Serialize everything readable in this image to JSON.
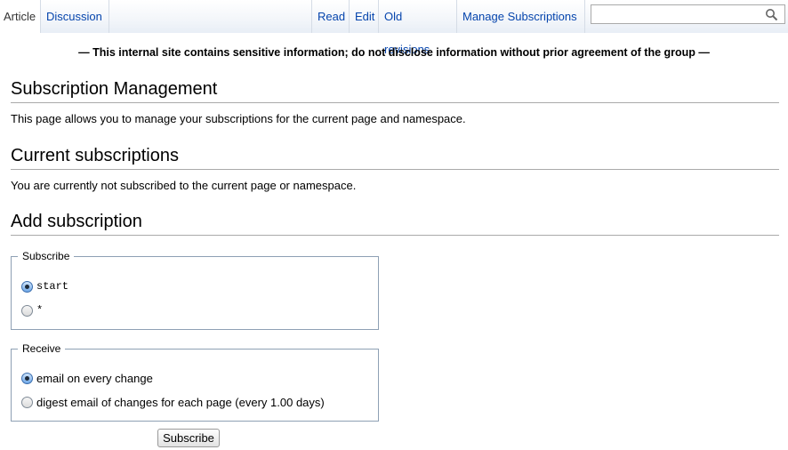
{
  "tabs": {
    "left": [
      {
        "label": "Article",
        "selected": true
      },
      {
        "label": "Discussion",
        "selected": false
      }
    ],
    "right": [
      {
        "label": "Read"
      },
      {
        "label": "Edit"
      },
      {
        "label": "Old revisions"
      },
      {
        "label": "Manage Subscriptions"
      }
    ]
  },
  "search": {
    "value": "",
    "icon": "search-icon"
  },
  "notice": "— This internal site contains sensitive information; do not disclose information without prior agreement of the group —",
  "sections": {
    "subscription_management": {
      "title": "Subscription Management",
      "text": "This page allows you to manage your subscriptions for the current page and namespace."
    },
    "current": {
      "title": "Current subscriptions",
      "text": "You are currently not subscribed to the current page or namespace."
    },
    "add": {
      "title": "Add subscription"
    }
  },
  "subscribe_fieldset": {
    "legend": "Subscribe",
    "options": [
      {
        "label": "start",
        "checked": true
      },
      {
        "label": "*",
        "checked": false
      }
    ]
  },
  "receive_fieldset": {
    "legend": "Receive",
    "options": [
      {
        "label": "email on every change",
        "checked": true
      },
      {
        "label": "digest email of changes for each page (every 1.00 days)",
        "checked": false
      }
    ]
  },
  "submit_label": "Subscribe",
  "colors": {
    "link": "#0645ad",
    "fieldset_border": "#8ea0b4"
  }
}
